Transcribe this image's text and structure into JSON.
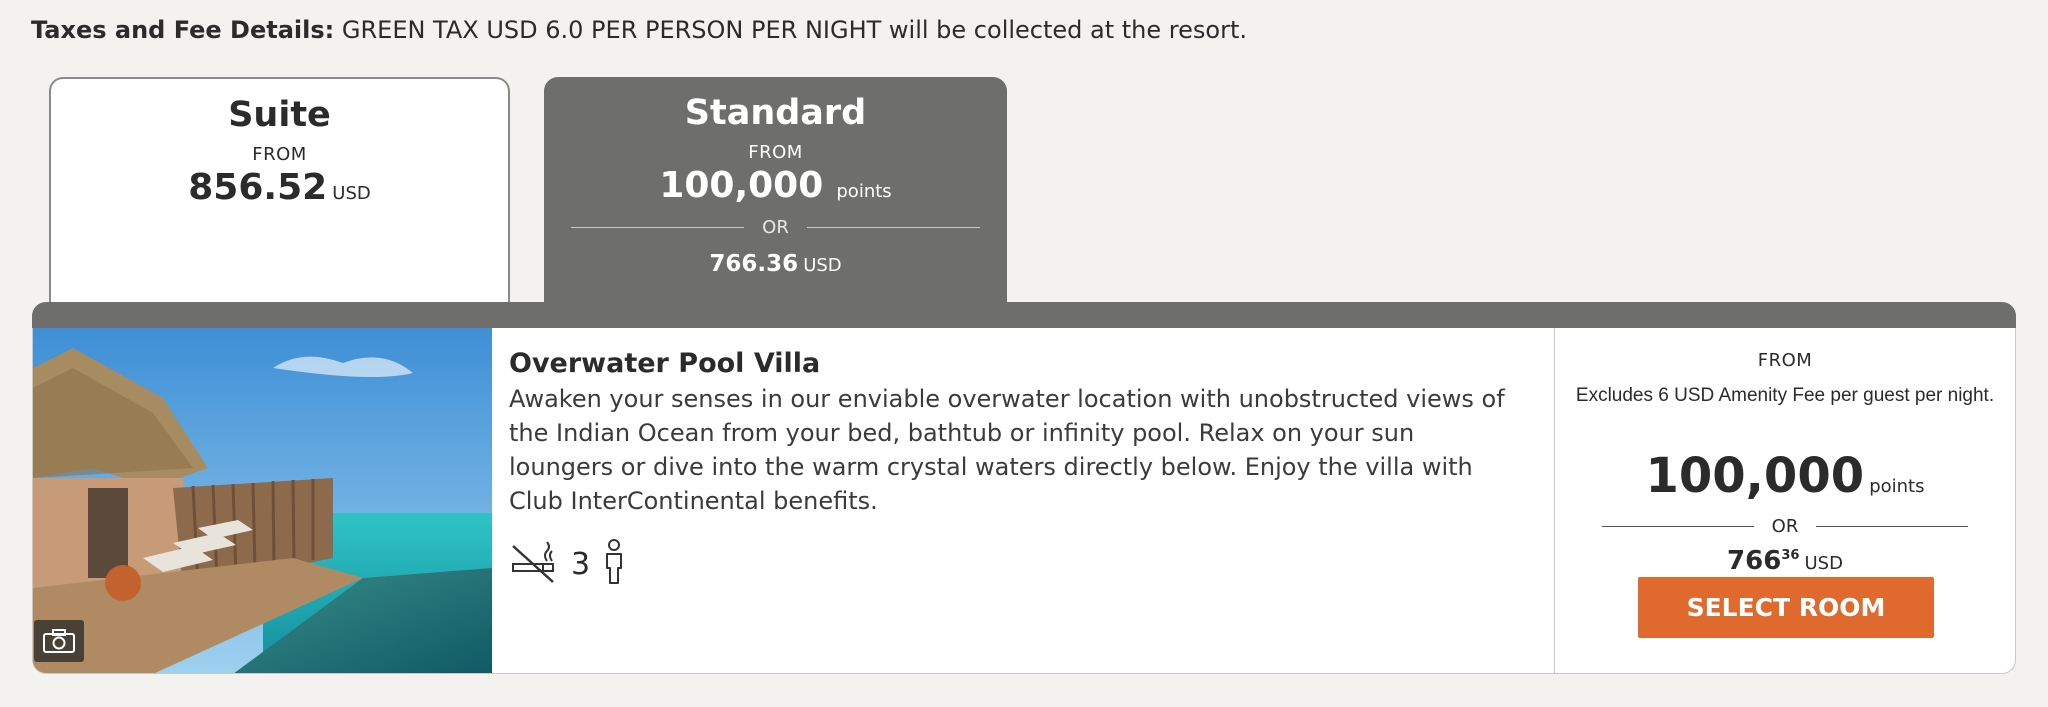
{
  "taxes": {
    "label": "Taxes and Fee Details:",
    "text": "GREEN TAX USD 6.0 PER PERSON PER NIGHT will be collected at the resort."
  },
  "tabs": [
    {
      "title": "Suite",
      "from": "FROM",
      "price": "856.52",
      "unit": "USD",
      "selected": false
    },
    {
      "title": "Standard",
      "from": "FROM",
      "points": "100,000",
      "points_unit": "points",
      "or": "OR",
      "cash": "766.36",
      "cash_unit": "USD",
      "selected": true
    }
  ],
  "room": {
    "name": "Overwater Pool Villa",
    "description": "Awaken your senses in our enviable overwater location with unobstructed views of the Indian Ocean from your bed, bathtub or infinity pool. Relax on your sun loungers or dive into the warm crystal waters directly below. Enjoy the villa with Club InterContinental benefits.",
    "guests": "3",
    "icons": [
      "no-smoking-icon",
      "person-icon",
      "camera-icon"
    ],
    "price": {
      "from": "FROM",
      "excludes": "Excludes 6 USD Amenity Fee per guest per night.",
      "points": "100,000",
      "points_unit": "points",
      "or": "OR",
      "cash_main": "766",
      "cash_cents": "36",
      "cash_unit": "USD",
      "button": "SELECT ROOM"
    }
  },
  "colors": {
    "background": "#f3f2ee",
    "tab_selected": "#6e6f6d",
    "button": "#e06a2d"
  }
}
